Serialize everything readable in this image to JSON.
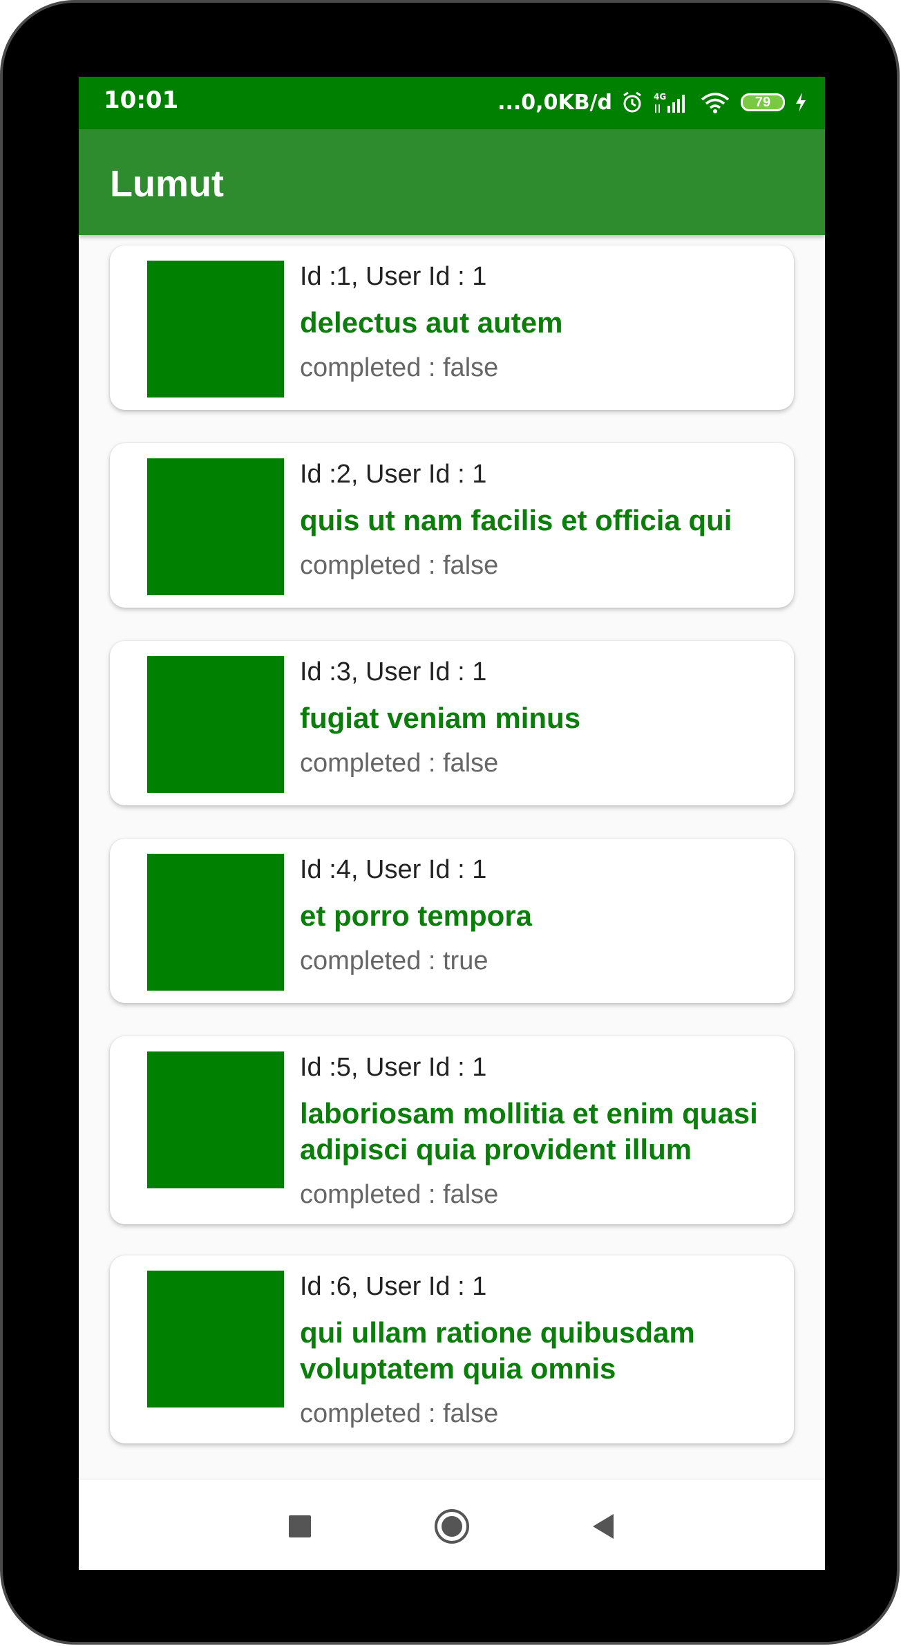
{
  "status_bar": {
    "time": "10:01",
    "network_speed": "...0,0KB/d",
    "network_type": "4G",
    "battery_level": "79"
  },
  "app_bar": {
    "title": "Lumut"
  },
  "colors": {
    "primary_dark": "#008000",
    "primary": "#2e8b2e",
    "title_text": "#0a7d0a",
    "thumbnail": "#008000"
  },
  "todos": [
    {
      "header": "Id :1, User Id : 1",
      "title": "delectus aut autem",
      "status": "completed : false"
    },
    {
      "header": "Id :2, User Id : 1",
      "title": "quis ut nam facilis et officia qui",
      "status": "completed : false"
    },
    {
      "header": "Id :3, User Id : 1",
      "title": "fugiat veniam minus",
      "status": "completed : false"
    },
    {
      "header": "Id :4, User Id : 1",
      "title": "et porro tempora",
      "status": "completed : true"
    },
    {
      "header": "Id :5, User Id : 1",
      "title": "laboriosam mollitia et enim quasi adipisci quia provident illum",
      "status": "completed : false"
    },
    {
      "header": "Id :6, User Id : 1",
      "title": "qui ullam ratione quibusdam voluptatem quia omnis",
      "status": "completed : false"
    }
  ],
  "nav_bar": {
    "icons": [
      "recents-square-icon",
      "home-circle-icon",
      "back-triangle-icon"
    ]
  }
}
